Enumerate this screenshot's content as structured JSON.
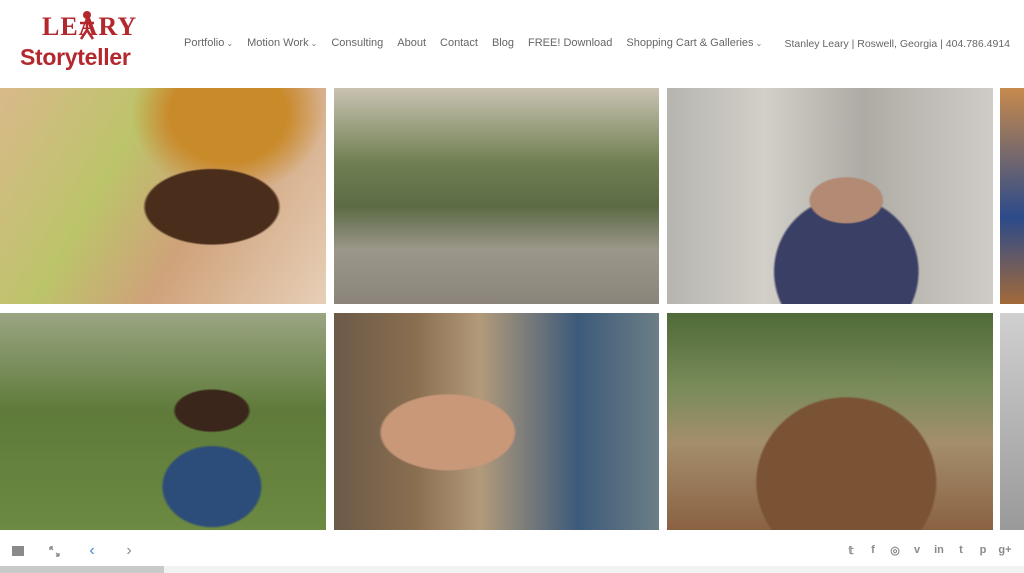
{
  "logo": {
    "line1": "LEARY",
    "line2": "Storyteller"
  },
  "nav": [
    {
      "label": "Portfolio",
      "has_menu": true
    },
    {
      "label": "Motion Work",
      "has_menu": true
    },
    {
      "label": "Consulting",
      "has_menu": false
    },
    {
      "label": "About",
      "has_menu": false
    },
    {
      "label": "Contact",
      "has_menu": false
    },
    {
      "label": "Blog",
      "has_menu": false
    },
    {
      "label": "FREE! Download",
      "has_menu": false
    },
    {
      "label": "Shopping Cart & Galleries",
      "has_menu": true
    }
  ],
  "contact_line": "Stanley Leary | Roswell, Georgia | 404.786.4914",
  "colors": {
    "brand_red": "#b3282d",
    "active_arrow": "#4a84d4"
  },
  "controls": {
    "grid_icon": "grid-icon",
    "fullscreen_icon": "fullscreen-icon",
    "prev_icon": "chevron-left-icon",
    "next_icon": "chevron-right-icon"
  },
  "progress": {
    "fraction": 0.16
  },
  "social_icons": [
    "twitter-icon",
    "facebook-icon",
    "instagram-icon",
    "vimeo-icon",
    "linkedin-icon",
    "tumblr-icon",
    "pinterest-icon",
    "googleplus-icon"
  ],
  "social_glyphs": [
    "𝕥",
    "f",
    "◎",
    "v",
    "in",
    "t",
    "p",
    "g+"
  ]
}
